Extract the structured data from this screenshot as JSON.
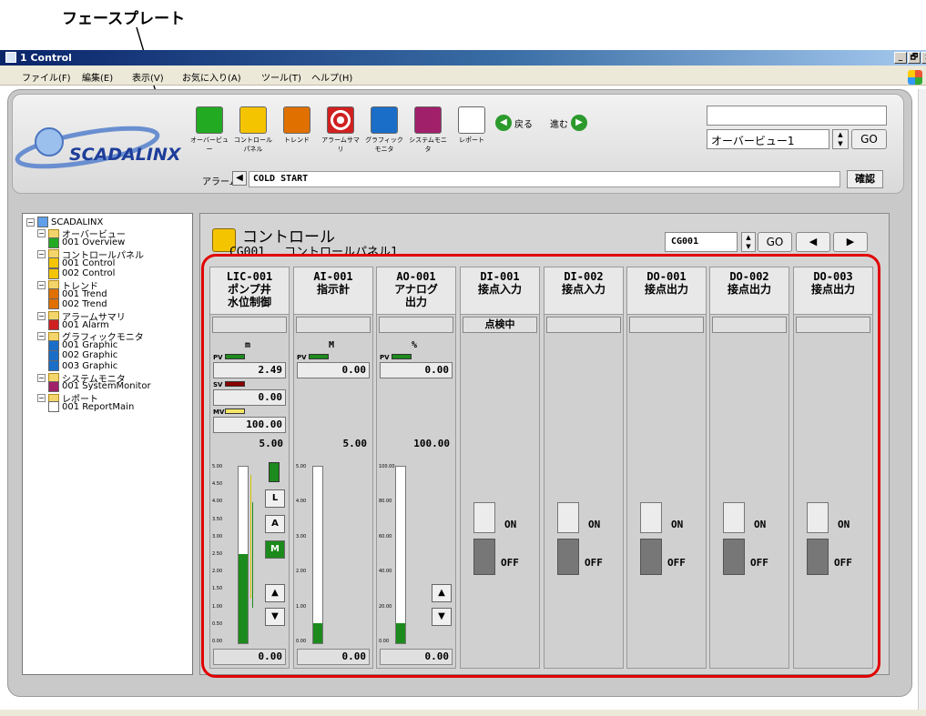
{
  "annotation": {
    "label": "フェースプレート"
  },
  "window": {
    "title": "1 Control",
    "min": "_",
    "max": "🗗",
    "close": "x"
  },
  "menu": [
    "ファイル(F)",
    "編集(E)",
    "表示(V)",
    "お気に入り(A)",
    "ツール(T)",
    "ヘルプ(H)"
  ],
  "toolbar": {
    "buttons": [
      {
        "label": "オーバービュー",
        "icon": "overview-grid-icon",
        "color": "#22aa22"
      },
      {
        "label": "コントロールパネル",
        "icon": "control-panel-icon",
        "color": "#f5c400"
      },
      {
        "label": "トレンド",
        "icon": "trend-icon",
        "color": "#e07000"
      },
      {
        "label": "アラームサマリ",
        "icon": "alarm-target-icon",
        "color": "#d02020"
      },
      {
        "label": "グラフィックモニタ",
        "icon": "graphic-monitor-icon",
        "color": "#1a6ec8"
      },
      {
        "label": "システムモニタ",
        "icon": "system-monitor-icon",
        "color": "#a0206a"
      },
      {
        "label": "レポート",
        "icon": "report-doc-icon",
        "color": "#ffffff"
      }
    ],
    "back": "戻る",
    "forward": "進む",
    "overview_value": "オーバービュー1",
    "go": "GO",
    "alarm_label": "アラーム",
    "alarm_text": "COLD START",
    "ack": "確認"
  },
  "logo": {
    "text": "SCADALINX"
  },
  "tree": [
    {
      "label": "SCADALINX",
      "level": 0,
      "kind": "root"
    },
    {
      "label": "オーバービュー",
      "level": 1,
      "kind": "folder"
    },
    {
      "label": "001 Overview",
      "level": 2,
      "kind": "overview"
    },
    {
      "label": "コントロールパネル",
      "level": 1,
      "kind": "folder"
    },
    {
      "label": "001 Control",
      "level": 2,
      "kind": "control"
    },
    {
      "label": "002 Control",
      "level": 2,
      "kind": "control"
    },
    {
      "label": "トレンド",
      "level": 1,
      "kind": "folder"
    },
    {
      "label": "001 Trend",
      "level": 2,
      "kind": "trend"
    },
    {
      "label": "002 Trend",
      "level": 2,
      "kind": "trend"
    },
    {
      "label": "アラームサマリ",
      "level": 1,
      "kind": "folder"
    },
    {
      "label": "001 Alarm",
      "level": 2,
      "kind": "alarm"
    },
    {
      "label": "グラフィックモニタ",
      "level": 1,
      "kind": "folder"
    },
    {
      "label": "001 Graphic",
      "level": 2,
      "kind": "graphic"
    },
    {
      "label": "002 Graphic",
      "level": 2,
      "kind": "graphic"
    },
    {
      "label": "003 Graphic",
      "level": 2,
      "kind": "graphic"
    },
    {
      "label": "システムモニタ",
      "level": 1,
      "kind": "folder"
    },
    {
      "label": "001 SystemMonitor",
      "level": 2,
      "kind": "system"
    },
    {
      "label": "レポート",
      "level": 1,
      "kind": "folder"
    },
    {
      "label": "001 ReportMain",
      "level": 2,
      "kind": "report"
    }
  ],
  "control": {
    "title": "コントロール",
    "subtitle": "CG001　 コントロールパネル1",
    "group_value": "CG001",
    "go": "GO",
    "prev": "◀",
    "next": "▶"
  },
  "faceplates": [
    {
      "tag": "LIC-001",
      "desc": "ポンプ井\n水位制御",
      "status": "",
      "unit": "m",
      "pv": "2.49",
      "sv": "0.00",
      "mv": "100.00",
      "range": "5.00",
      "bottom": "0.00",
      "ticks": [
        "5.00",
        "4.50",
        "4.00",
        "3.50",
        "3.00",
        "2.50",
        "2.00",
        "1.50",
        "1.00",
        "0.50",
        "0.00"
      ],
      "level": 0.498,
      "modes": [
        "L",
        "A",
        "M"
      ]
    },
    {
      "tag": "AI-001",
      "desc": "指示計",
      "status": "",
      "unit": "M",
      "pv": "0.00",
      "range": "5.00",
      "bottom": "0.00",
      "ticks": [
        "5.00",
        "4.00",
        "3.00",
        "2.00",
        "1.00",
        "0.00"
      ],
      "level": 0.11
    },
    {
      "tag": "AO-001",
      "desc": "アナログ\n出力",
      "status": "",
      "unit": "%",
      "pv": "0.00",
      "range": "100.00",
      "bottom": "0.00",
      "ticks": [
        "100.00",
        "80.00",
        "60.00",
        "40.00",
        "20.00",
        "0.00"
      ],
      "level": 0.11
    },
    {
      "tag": "DI-001",
      "desc": "接点入力",
      "status": "点検中",
      "on": "ON",
      "off": "OFF"
    },
    {
      "tag": "DI-002",
      "desc": "接点入力",
      "status": "",
      "on": "ON",
      "off": "OFF"
    },
    {
      "tag": "DO-001",
      "desc": "接点出力",
      "status": "",
      "on": "ON",
      "off": "OFF"
    },
    {
      "tag": "DO-002",
      "desc": "接点出力",
      "status": "",
      "on": "ON",
      "off": "OFF"
    },
    {
      "tag": "DO-003",
      "desc": "接点出力",
      "status": "",
      "on": "ON",
      "off": "OFF"
    }
  ],
  "labels": {
    "pv": "PV",
    "sv": "SV",
    "mv": "MV"
  },
  "colors": {
    "pv": "#1c8a1c",
    "sv": "#8b0000",
    "mv": "#f5e663",
    "highlight": "#e10000"
  }
}
